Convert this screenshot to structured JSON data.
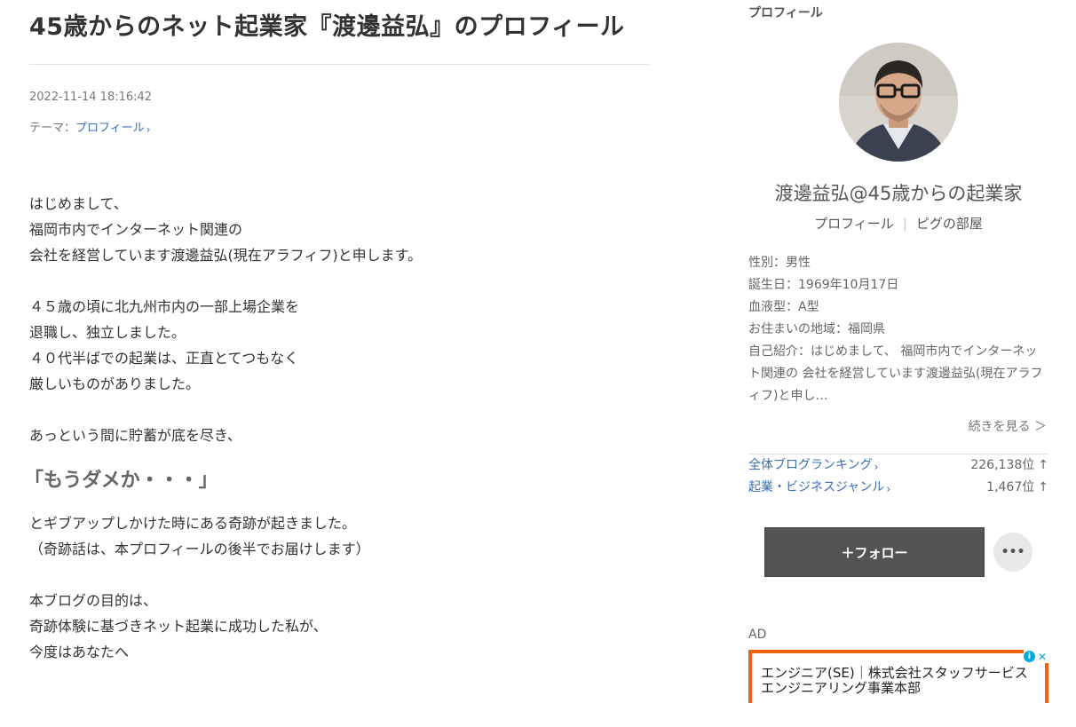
{
  "article": {
    "title": "45歳からのネット起業家『渡邊益弘』のプロフィール",
    "date": "2022-11-14 18:16:42",
    "theme_label": "テーマ：",
    "theme_link": "プロフィール",
    "lines": {
      "l1": "はじめまして、",
      "l2": "福岡市内でインターネット関連の",
      "l3": "会社を経営しています渡邊益弘(現在アラフィフ)と申します。",
      "l4": "４５歳の頃に北九州市内の一部上場企業を",
      "l5": "退職し、独立しました。",
      "l6": "４０代半ばでの起業は、正直とてつもなく",
      "l7": "厳しいものがありました。",
      "l8": "あっという間に貯蓄が底を尽き、",
      "emph": "「もうダメか・・・」",
      "l9": "とギブアップしかけた時にある奇跡が起きました。",
      "l10": "（奇跡話は、本プロフィールの後半でお届けします）",
      "l11": "本ブログの目的は、",
      "l12": "奇跡体験に基づきネット起業に成功した私が、",
      "l13": "今度はあなたへ"
    }
  },
  "sidebar": {
    "heading": "プロフィール",
    "name": "渡邊益弘@45歳からの起業家",
    "link_profile": "プロフィール",
    "link_pig": "ピグの部屋",
    "info": {
      "gender": "性別：男性",
      "birthday": "誕生日：1969年10月17日",
      "blood": "血液型：A型",
      "area": "お住まいの地域：福岡県",
      "intro": "自己紹介：はじめまして、 福岡市内でインターネット関連の 会社を経営しています渡邊益弘(現在アラフィフ)と申し…"
    },
    "more": "続きを見る ＞",
    "ranking": {
      "overall_label": "全体ブログランキング",
      "overall_value": "226,138位",
      "genre_label": "起業・ビジネスジャンル",
      "genre_value": "1,467位",
      "arrow": "↑"
    },
    "follow_label": "＋フォロー",
    "more_menu": "•••",
    "ad_label": "AD",
    "ad_text": "エンジニア(SE)｜株式会社スタッフサービス　エンジニアリング事業本部",
    "ad_info_icon": "i",
    "ad_close_icon": "✕"
  },
  "colors": {
    "link": "#3d6eb5",
    "follow_bg": "#545454",
    "ad_border": "#f0630e",
    "ad_icon": "#00a9e0"
  }
}
